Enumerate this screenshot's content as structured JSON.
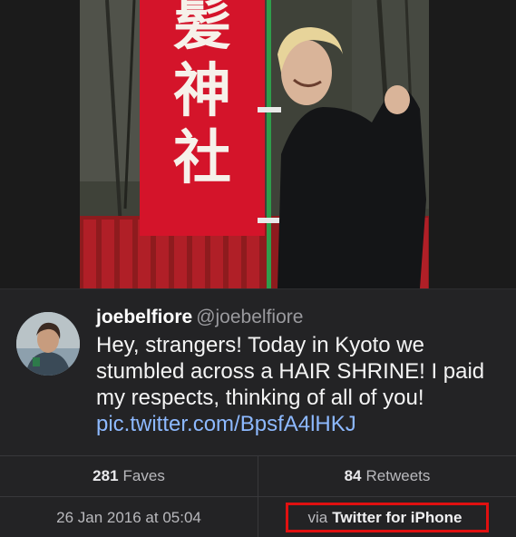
{
  "tweet": {
    "display_name": "joebelfiore",
    "handle": "@joebelfiore",
    "text_before_link": "Hey, strangers! Today in Kyoto we stumbled across a HAIR SHRINE! I paid my respects, thinking of all of you! ",
    "link": "pic.twitter.com/BpsfA4lHKJ"
  },
  "stats": {
    "faves_count": "281",
    "faves_label": "Faves",
    "retweets_count": "84",
    "retweets_label": "Retweets",
    "date": "26 Jan 2016 at 05:04",
    "via_prefix": "via",
    "via_source": "Twitter for iPhone"
  },
  "photo": {
    "banner_text": "髪神社",
    "banner_color": "#d4142a"
  },
  "colors": {
    "background": "#232325",
    "link": "#8db9ff",
    "highlight": "#e01010"
  }
}
